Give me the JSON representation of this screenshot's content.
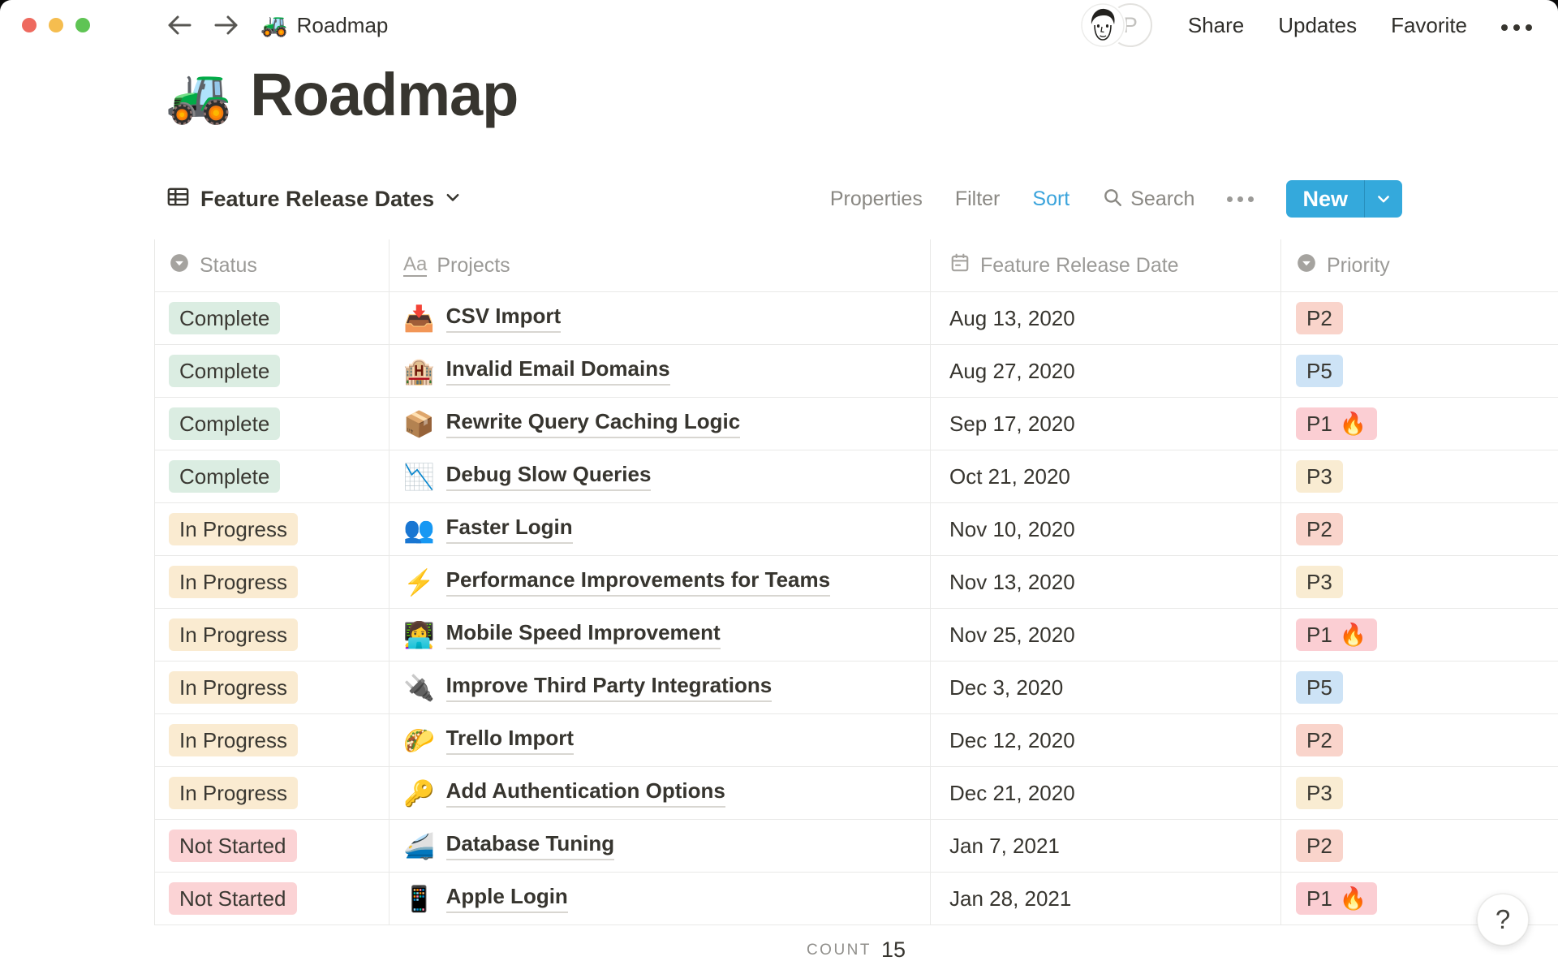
{
  "topbar": {
    "breadcrumb_emoji": "🚜",
    "breadcrumb_title": "Roadmap",
    "share": "Share",
    "updates": "Updates",
    "favorite": "Favorite",
    "avatar_letter": "P"
  },
  "page": {
    "emoji": "🚜",
    "title": "Roadmap"
  },
  "toolbar": {
    "view_name": "Feature Release Dates",
    "properties": "Properties",
    "filter": "Filter",
    "sort": "Sort",
    "search": "Search",
    "new_label": "New"
  },
  "icons": {
    "text_type": "Aa"
  },
  "table": {
    "headers": [
      {
        "label": "Status",
        "type": "select"
      },
      {
        "label": "Projects",
        "type": "text"
      },
      {
        "label": "Feature Release Date",
        "type": "date"
      },
      {
        "label": "Priority",
        "type": "select"
      }
    ],
    "fire_emoji": "🔥",
    "rows": [
      {
        "status": "Complete",
        "emoji": "📥",
        "project": "CSV Import",
        "date": "Aug 13, 2020",
        "priority": "P2",
        "fire": false
      },
      {
        "status": "Complete",
        "emoji": "🏨",
        "project": "Invalid Email Domains",
        "date": "Aug 27, 2020",
        "priority": "P5",
        "fire": false
      },
      {
        "status": "Complete",
        "emoji": "📦",
        "project": "Rewrite Query Caching Logic",
        "date": "Sep 17, 2020",
        "priority": "P1",
        "fire": true
      },
      {
        "status": "Complete",
        "emoji": "📉",
        "project": "Debug Slow Queries",
        "date": "Oct 21, 2020",
        "priority": "P3",
        "fire": false
      },
      {
        "status": "In Progress",
        "emoji": "👥",
        "project": "Faster Login",
        "date": "Nov 10, 2020",
        "priority": "P2",
        "fire": false
      },
      {
        "status": "In Progress",
        "emoji": "⚡",
        "project": "Performance Improvements for Teams",
        "date": "Nov 13, 2020",
        "priority": "P3",
        "fire": false
      },
      {
        "status": "In Progress",
        "emoji": "👩‍💻",
        "project": "Mobile Speed Improvement",
        "date": "Nov 25, 2020",
        "priority": "P1",
        "fire": true
      },
      {
        "status": "In Progress",
        "emoji": "🔌",
        "project": "Improve Third Party Integrations",
        "date": "Dec 3, 2020",
        "priority": "P5",
        "fire": false
      },
      {
        "status": "In Progress",
        "emoji": "🌮",
        "project": "Trello Import",
        "date": "Dec 12, 2020",
        "priority": "P2",
        "fire": false
      },
      {
        "status": "In Progress",
        "emoji": "🔑",
        "project": "Add Authentication Options",
        "date": "Dec 21, 2020",
        "priority": "P3",
        "fire": false
      },
      {
        "status": "Not Started",
        "emoji": "🚄",
        "project": "Database Tuning",
        "date": "Jan 7, 2021",
        "priority": "P2",
        "fire": false
      },
      {
        "status": "Not Started",
        "emoji": "📱",
        "project": "Apple Login",
        "date": "Jan 28, 2021",
        "priority": "P1",
        "fire": true
      }
    ]
  },
  "footer": {
    "count_label": "COUNT",
    "count_value": "15"
  },
  "help_label": "?",
  "colors": {
    "accent_blue": "#34A9DC",
    "sort_active_blue": "#3BA4DC",
    "status": {
      "Complete": "#DBEDE2",
      "In Progress": "#FAEBD1",
      "Not Started": "#FBD3D5"
    },
    "priority": {
      "P1": "#FBCED3",
      "P2": "#F9D4CB",
      "P3": "#F9ECD2",
      "P5": "#CDE3F6"
    },
    "traffic": {
      "red": "#EE6A5F",
      "yellow": "#F5BD4F",
      "green": "#5FC454"
    }
  }
}
